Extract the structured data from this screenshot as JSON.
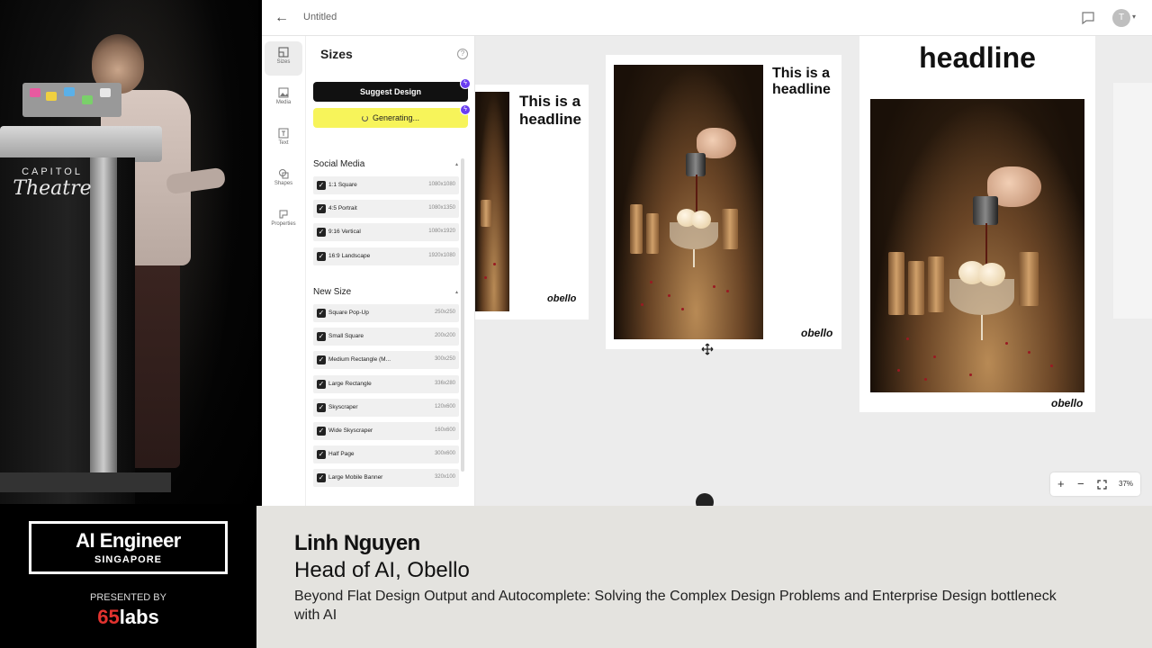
{
  "app": {
    "title": "Untitled",
    "avatar_initial": "T"
  },
  "rail": [
    {
      "label": "Sizes",
      "icon": "sizes-icon"
    },
    {
      "label": "Media",
      "icon": "media-icon"
    },
    {
      "label": "Text",
      "icon": "text-icon"
    },
    {
      "label": "Shapes",
      "icon": "shapes-icon"
    },
    {
      "label": "Properties",
      "icon": "properties-icon"
    }
  ],
  "panel": {
    "title": "Sizes",
    "suggest_label": "Suggest Design",
    "generating_label": "Generating...",
    "social": {
      "heading": "Social Media",
      "items": [
        {
          "name": "1:1 Square",
          "dims": "1080x1080"
        },
        {
          "name": "4:5 Portrait",
          "dims": "1080x1350"
        },
        {
          "name": "9:16 Vertical",
          "dims": "1080x1920"
        },
        {
          "name": "16:9 Landscape",
          "dims": "1920x1080"
        }
      ]
    },
    "new": {
      "heading": "New Size",
      "items": [
        {
          "name": "Square Pop-Up",
          "dims": "250x250"
        },
        {
          "name": "Small Square",
          "dims": "200x200"
        },
        {
          "name": "Medium Rectangle (M...",
          "dims": "300x250"
        },
        {
          "name": "Large Rectangle",
          "dims": "336x280"
        },
        {
          "name": "Skyscraper",
          "dims": "120x600"
        },
        {
          "name": "Wide Skyscraper",
          "dims": "160x600"
        },
        {
          "name": "Half Page",
          "dims": "300x600"
        },
        {
          "name": "Large Mobile Banner",
          "dims": "320x100"
        }
      ]
    }
  },
  "canvas": {
    "headline_1": "This is a headline",
    "headline_2": "This is a headline",
    "headline_3": "headline",
    "logo": "obello",
    "zoom": "37%"
  },
  "lower_third": {
    "event_name": "AI Engineer",
    "event_location": "SINGAPORE",
    "presented_by": "PRESENTED BY",
    "sponsor_num": "65",
    "sponsor_word": "labs",
    "speaker_name": "Linh Nguyen",
    "speaker_role": "Head of AI, Obello",
    "talk_title": "Beyond Flat Design Output and Autocomplete: Solving the Complex Design Problems and Enterprise Design bottleneck with AI"
  },
  "podium": {
    "line1": "CAPITOL",
    "line2": "Theatre"
  }
}
